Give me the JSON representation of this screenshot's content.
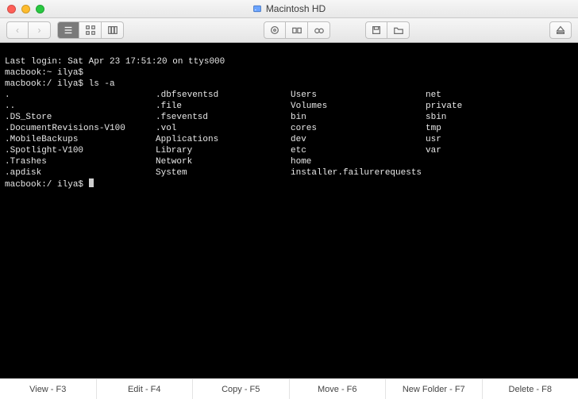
{
  "window": {
    "title": "Macintosh HD"
  },
  "toolbar": {
    "back": "‹",
    "forward": "›"
  },
  "terminal": {
    "last_login": "Last login: Sat Apr 23 17:51:20 on ttys000",
    "prompt1": "macbook:~ ilya$",
    "prompt2_host": "macbook:/ ilya$ ",
    "prompt2_cmd": "ls -a",
    "prompt3_host": "macbook:/ ilya$ ",
    "ls": {
      "col1": [
        ".",
        "..",
        ".DS_Store",
        ".DocumentRevisions-V100",
        ".MobileBackups",
        ".Spotlight-V100",
        ".Trashes",
        ".apdisk"
      ],
      "col2": [
        ".dbfseventsd",
        ".file",
        ".fseventsd",
        ".vol",
        "Applications",
        "Library",
        "Network",
        "System"
      ],
      "col3": [
        "Users",
        "Volumes",
        "bin",
        "cores",
        "dev",
        "etc",
        "home",
        "installer.failurerequests"
      ],
      "col4": [
        "net",
        "private",
        "sbin",
        "tmp",
        "usr",
        "var",
        "",
        ""
      ]
    }
  },
  "footer": {
    "view": "View - F3",
    "edit": "Edit - F4",
    "copy": "Copy - F5",
    "move": "Move - F6",
    "newfolder": "New Folder - F7",
    "delete": "Delete - F8"
  }
}
